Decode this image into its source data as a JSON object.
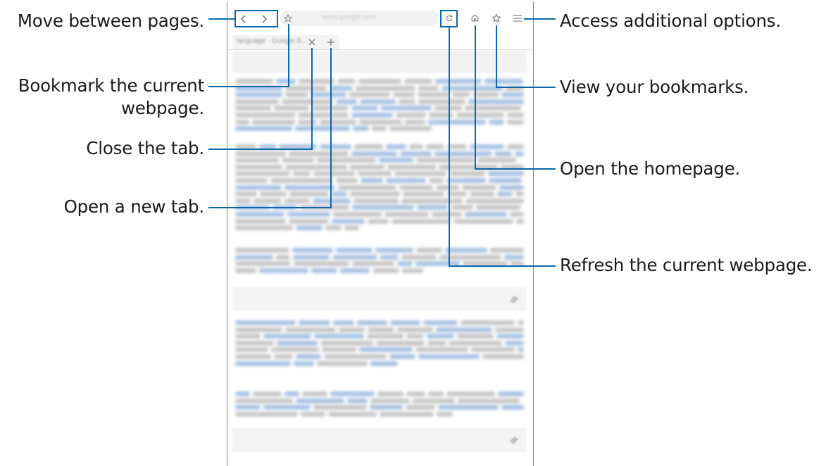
{
  "callouts": {
    "move_pages": "Move between pages.",
    "bookmark_line1": "Bookmark the current",
    "bookmark_line2": "webpage.",
    "close_tab": "Close the tab.",
    "new_tab": "Open a new tab.",
    "additional_options": "Access additional options.",
    "view_bookmarks": "View your bookmarks.",
    "homepage": "Open the homepage.",
    "refresh": "Refresh the current webpage."
  },
  "browser": {
    "url_text": "www.google.com",
    "tab_title": "language · Google S...",
    "icons": [
      "back-arrow-icon",
      "forward-arrow-icon",
      "star-icon",
      "refresh-icon",
      "home-icon",
      "bookmarks-icon",
      "menu-icon",
      "close-icon",
      "plus-icon",
      "link-icon"
    ]
  },
  "colors": {
    "callout_line": "#0c67a8",
    "frame": "#8a8a8a",
    "text": "#1a1a1a"
  }
}
